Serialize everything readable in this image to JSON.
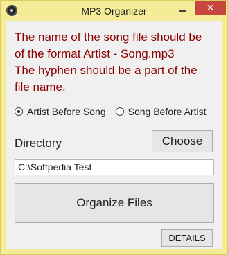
{
  "window": {
    "title": "MP3 Organizer",
    "close_glyph": "✕",
    "icon": "app-icon"
  },
  "info": {
    "lines": [
      "The name of the song file should be",
      "of the format Artist - Song.mp3",
      "The hyphen should be a part of the",
      "file name."
    ],
    "color": "#8b0000"
  },
  "options": {
    "artist_before_song": "Artist Before Song",
    "song_before_artist": "Song Before Artist",
    "selected": "artist_before_song"
  },
  "directory": {
    "label": "Directory",
    "choose_label": "Choose",
    "value": "C:\\Softpedia Test"
  },
  "actions": {
    "organize_label": "Organize Files",
    "details_label": "DETAILS"
  },
  "colors": {
    "frame": "#f5ec98",
    "close": "#c7473f",
    "client": "#f0f0f0"
  }
}
